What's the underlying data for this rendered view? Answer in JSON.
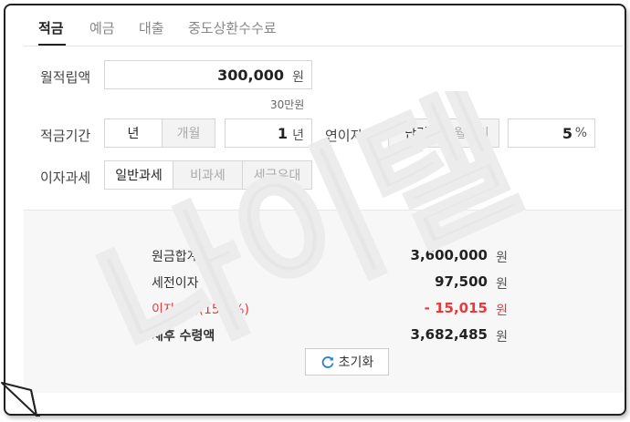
{
  "tabs": [
    {
      "label": "적금",
      "active": true
    },
    {
      "label": "예금",
      "active": false
    },
    {
      "label": "대출",
      "active": false
    },
    {
      "label": "중도상환수수료",
      "active": false
    }
  ],
  "form": {
    "monthly": {
      "label": "월적립액",
      "value": "300,000",
      "unit": "원",
      "hint": "30만원"
    },
    "period": {
      "label": "적금기간",
      "options": [
        "년",
        "개월"
      ],
      "selected": "년",
      "value": "1",
      "unit": "년"
    },
    "rate": {
      "label": "연이자율",
      "options": [
        "단리",
        "월복리"
      ],
      "selected": "단리",
      "value": "5",
      "unit": "%"
    },
    "tax": {
      "label": "이자과세",
      "options": [
        "일반과세",
        "비과세",
        "세금우대"
      ],
      "selected": "일반과세"
    }
  },
  "results": [
    {
      "label": "원금합계",
      "value": "3,600,000",
      "unit": "원",
      "style": "normal"
    },
    {
      "label": "세전이자",
      "value": "97,500",
      "unit": "원",
      "style": "normal"
    },
    {
      "label": "이자과세(15.4%)",
      "value": "- 15,015",
      "unit": "원",
      "style": "red"
    },
    {
      "label": "세후 수령액",
      "value": "3,682,485",
      "unit": "원",
      "style": "bold"
    }
  ],
  "reset_label": "초기화",
  "watermark_text": "나이텔",
  "colors": {
    "accent_red": "#e8383d",
    "watermark": "#e6e6e6"
  }
}
